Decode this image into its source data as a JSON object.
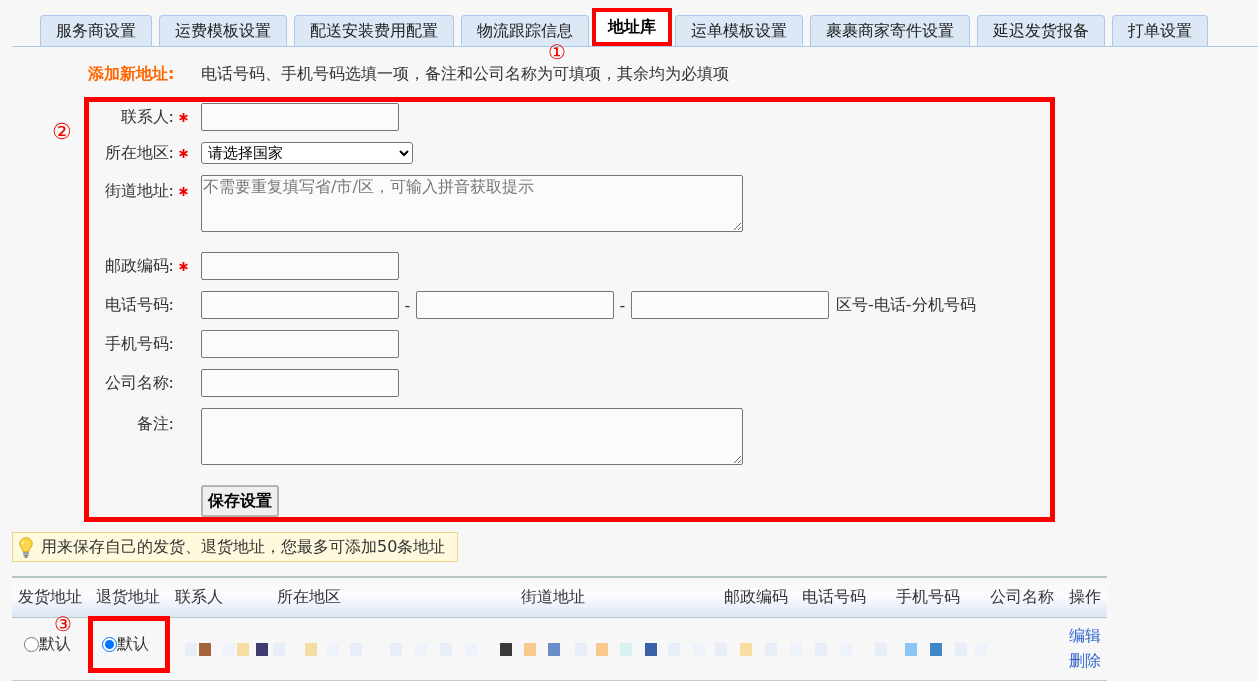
{
  "tab_bar": {
    "tabs": [
      {
        "label": "服务商设置",
        "selected": false,
        "highlighted": false
      },
      {
        "label": "运费模板设置",
        "selected": false,
        "highlighted": false
      },
      {
        "label": "配送安装费用配置",
        "selected": false,
        "highlighted": false
      },
      {
        "label": "物流跟踪信息",
        "selected": false,
        "highlighted": false
      },
      {
        "label": "地址库",
        "selected": true,
        "highlighted": true
      },
      {
        "label": "运单模板设置",
        "selected": false,
        "highlighted": false
      },
      {
        "label": "裹裹商家寄件设置",
        "selected": false,
        "highlighted": false
      },
      {
        "label": "延迟发货报备",
        "selected": false,
        "highlighted": false
      },
      {
        "label": "打单设置",
        "selected": false,
        "highlighted": false
      }
    ],
    "annotation": "①"
  },
  "form": {
    "heading": "添加新地址:",
    "instructions": "电话号码、手机号码选填一项，备注和公司名称为可填项，其余均为必填项",
    "highlighted": true,
    "annotation": "②",
    "fields": [
      {
        "kind": "text",
        "label": "联系人:",
        "required": true
      },
      {
        "kind": "select",
        "label": "所在地区:",
        "required": true,
        "value": "请选择国家"
      },
      {
        "kind": "textarea",
        "label": "街道地址:",
        "required": true,
        "placeholder": "不需要重复填写省/市/区，可输入拼音获取提示"
      },
      {
        "kind": "text",
        "label": "邮政编码:",
        "required": true
      },
      {
        "kind": "phone",
        "label": "电话号码:",
        "required": false,
        "parts": [
          {
            "kind": "input"
          },
          {
            "kind": "separator",
            "text": "-"
          },
          {
            "kind": "input"
          },
          {
            "kind": "separator",
            "text": "-"
          },
          {
            "kind": "input"
          },
          {
            "kind": "hint",
            "text": "区号-电话-分机号码"
          }
        ]
      },
      {
        "kind": "text",
        "label": "手机号码:",
        "required": false
      },
      {
        "kind": "text",
        "label": "公司名称:",
        "required": false
      },
      {
        "kind": "textarea",
        "label": "备注:",
        "required": false
      }
    ],
    "save_button": "保存设置"
  },
  "tip": "用来保存自己的发货、退货地址，您最多可添加50条地址",
  "address_table": {
    "columns": [
      "发货地址",
      "退货地址",
      "联系人",
      "所在地区",
      "街道地址",
      "邮政编码",
      "电话号码",
      "手机号码",
      "公司名称",
      "操作"
    ],
    "rows": [
      {
        "shipping_default": {
          "label": "默认",
          "selected": false,
          "highlighted": false
        },
        "return_default": {
          "label": "默认",
          "selected": true,
          "highlighted": true
        },
        "redacted": true,
        "annotation": "③",
        "actions": [
          "编辑",
          "删除"
        ]
      }
    ]
  }
}
